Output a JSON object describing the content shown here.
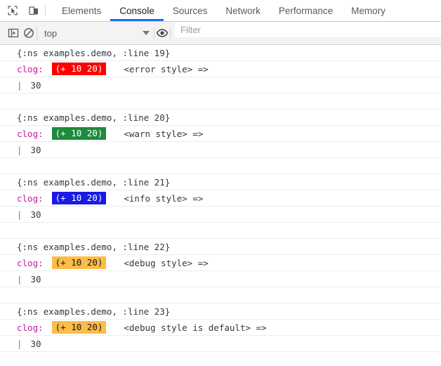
{
  "toolbar": {
    "inspect_icon": "inspect-cursor-icon",
    "device_icon": "device-toolbar-icon",
    "tabs": [
      {
        "label": "Elements",
        "active": false
      },
      {
        "label": "Console",
        "active": true
      },
      {
        "label": "Sources",
        "active": false
      },
      {
        "label": "Network",
        "active": false
      },
      {
        "label": "Performance",
        "active": false
      },
      {
        "label": "Memory",
        "active": false
      }
    ]
  },
  "filterbar": {
    "sidebar_toggle_icon": "console-sidebar-icon",
    "clear_icon": "clear-console-icon",
    "context_value": "top",
    "dropdown_icon": "chevron-down-icon",
    "eye_icon": "live-expression-eye-icon",
    "filter_placeholder": "Filter",
    "filter_value": ""
  },
  "console": {
    "label": "clog:",
    "badge_text": "(+ 10 20)",
    "value_prefix": "|",
    "entries": [
      {
        "ns": "{:ns examples.demo, :line 19}",
        "message": "<error style> =>",
        "value": "30",
        "badge_bg": "#ff0000",
        "badge_fg": "#ffffff"
      },
      {
        "ns": "{:ns examples.demo, :line 20}",
        "message": "<warn style> =>",
        "value": "30",
        "badge_bg": "#1e8a3c",
        "badge_fg": "#ffffff"
      },
      {
        "ns": "{:ns examples.demo, :line 21}",
        "message": "<info style> =>",
        "value": "30",
        "badge_bg": "#1a1ae6",
        "badge_fg": "#ffffff"
      },
      {
        "ns": "{:ns examples.demo, :line 22}",
        "message": "<debug style> =>",
        "value": "30",
        "badge_bg": "#fcbc48",
        "badge_fg": "#1a1a1a"
      },
      {
        "ns": "{:ns examples.demo, :line 23}",
        "message": "<debug style is default> =>",
        "value": "30",
        "badge_bg": "#fcbc48",
        "badge_fg": "#1a1a1a"
      }
    ]
  },
  "colors": {
    "accent": "#1a73e8",
    "clog_label": "#c41a9e",
    "text": "#303942"
  }
}
